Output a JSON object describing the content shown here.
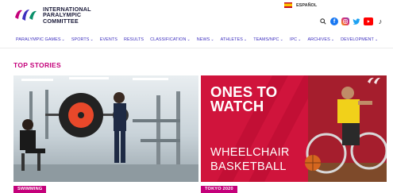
{
  "header": {
    "logo_lines": [
      "INTERNATIONAL",
      "PARALYMPIC",
      "COMMITTEE"
    ],
    "language_label": "ESPAÑOL"
  },
  "social_icons": [
    "search-icon",
    "facebook-icon",
    "instagram-icon",
    "twitter-icon",
    "youtube-icon",
    "tiktok-icon"
  ],
  "nav": {
    "items": [
      {
        "label": "PARALYMPIC GAMES",
        "dropdown": true
      },
      {
        "label": "SPORTS",
        "dropdown": true
      },
      {
        "label": "EVENTS",
        "dropdown": false
      },
      {
        "label": "RESULTS",
        "dropdown": false
      },
      {
        "label": "CLASSIFICATION",
        "dropdown": true
      },
      {
        "label": "NEWS",
        "dropdown": true
      },
      {
        "label": "ATHLETES",
        "dropdown": true
      },
      {
        "label": "TEAMS/NPC",
        "dropdown": true
      },
      {
        "label": "IPC",
        "dropdown": true
      },
      {
        "label": "ARCHIVES",
        "dropdown": true
      },
      {
        "label": "DEVELOPMENT",
        "dropdown": true
      }
    ]
  },
  "top_stories": {
    "title": "TOP STORIES",
    "cards": [
      {
        "category": "SWIMMING"
      },
      {
        "category": "TOKYO 2020",
        "headline": "ONES TO WATCH",
        "subheadline": "WHEELCHAIR BASKETBALL"
      }
    ]
  },
  "colors": {
    "brand_magenta": "#c4007a",
    "nav_text": "#3d2fbf",
    "card_red": "#d0143c"
  }
}
